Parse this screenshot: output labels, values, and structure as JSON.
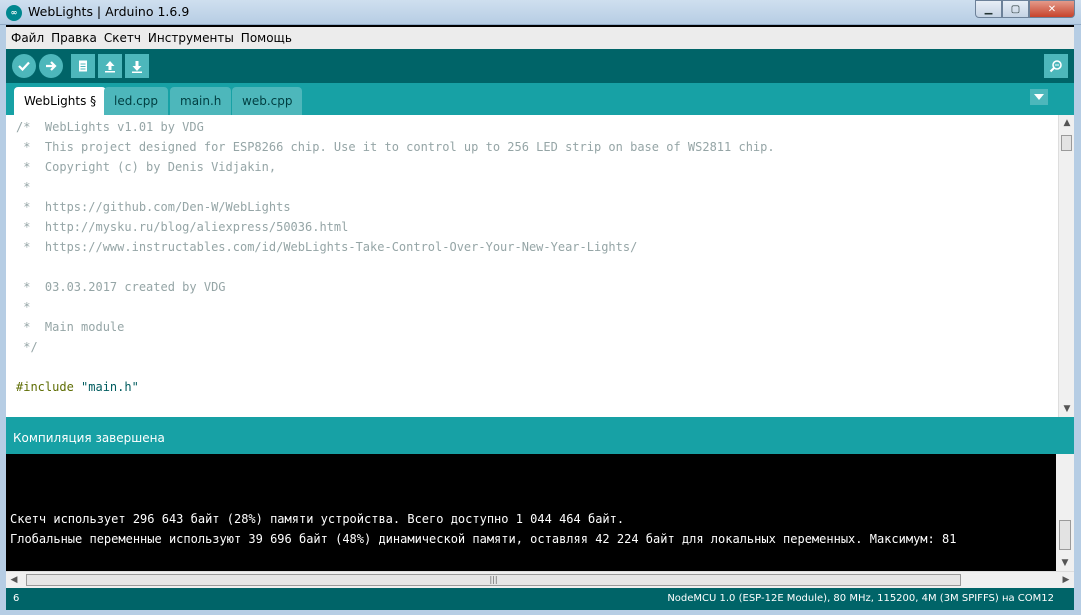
{
  "window": {
    "title": "WebLights | Arduino 1.6.9",
    "controls": {
      "minimize": "▁",
      "maximize": "▢",
      "close": "✕"
    }
  },
  "menu": [
    "Файл",
    "Правка",
    "Скетч",
    "Инструменты",
    "Помощь"
  ],
  "toolbar": {
    "buttons": [
      "verify-icon",
      "upload-icon",
      "new-icon",
      "open-icon",
      "save-icon"
    ],
    "serial_monitor": "serial-monitor-icon"
  },
  "tabs": [
    "WebLights §",
    "led.cpp",
    "main.h",
    "web.cpp"
  ],
  "editor": {
    "lines": [
      {
        "prefix": "/*  ",
        "text": "WebLights v1.01 by VDG",
        "kind": "comment"
      },
      {
        "prefix": " *  ",
        "text": "This project designed for ESP8266 chip. Use it to control up to 256 LED strip on base of WS2811 chip.",
        "kind": "comment"
      },
      {
        "prefix": " *  ",
        "text": "Copyright (c) by Denis Vidjakin,",
        "kind": "comment"
      },
      {
        "prefix": " *",
        "text": "",
        "kind": "comment"
      },
      {
        "prefix": " *  ",
        "text": "https://github.com/Den-W/WebLights",
        "kind": "link"
      },
      {
        "prefix": " *  ",
        "text": "http://mysku.ru/blog/aliexpress/50036.html",
        "kind": "link"
      },
      {
        "prefix": " *  ",
        "text": "https://www.instructables.com/id/WebLights-Take-Control-Over-Your-New-Year-Lights/",
        "kind": "link"
      },
      {
        "prefix": "",
        "text": "",
        "kind": "comment"
      },
      {
        "prefix": " *  ",
        "text": "03.03.2017 created by VDG",
        "kind": "comment"
      },
      {
        "prefix": " *",
        "text": "",
        "kind": "comment"
      },
      {
        "prefix": " *  ",
        "text": "Main module",
        "kind": "comment"
      },
      {
        "prefix": " */",
        "text": "",
        "kind": "comment"
      },
      {
        "prefix": "",
        "text": "",
        "kind": "comment"
      }
    ],
    "include_directive": "#include",
    "include_file": "\"main.h\""
  },
  "status": "Компиляция завершена",
  "console": [
    "Скетч использует 296 643 байт (28%) памяти устройства. Всего доступно 1 044 464 байт.",
    "Глобальные переменные используют 39 696 байт (48%) динамической памяти, оставляя 42 224 байт для локальных переменных. Максимум: 81"
  ],
  "footer": {
    "line_number": "6",
    "board": "NodeMCU 1.0 (ESP-12E Module), 80 MHz, 115200, 4M (3M SPIFFS) на COM12"
  },
  "colors": {
    "toolbar": "#006468",
    "tabbar": "#17a1a5",
    "button": "#4db7bb",
    "comment": "#95a5a6",
    "preprocessor": "#5e6d03",
    "string": "#005c5f"
  }
}
